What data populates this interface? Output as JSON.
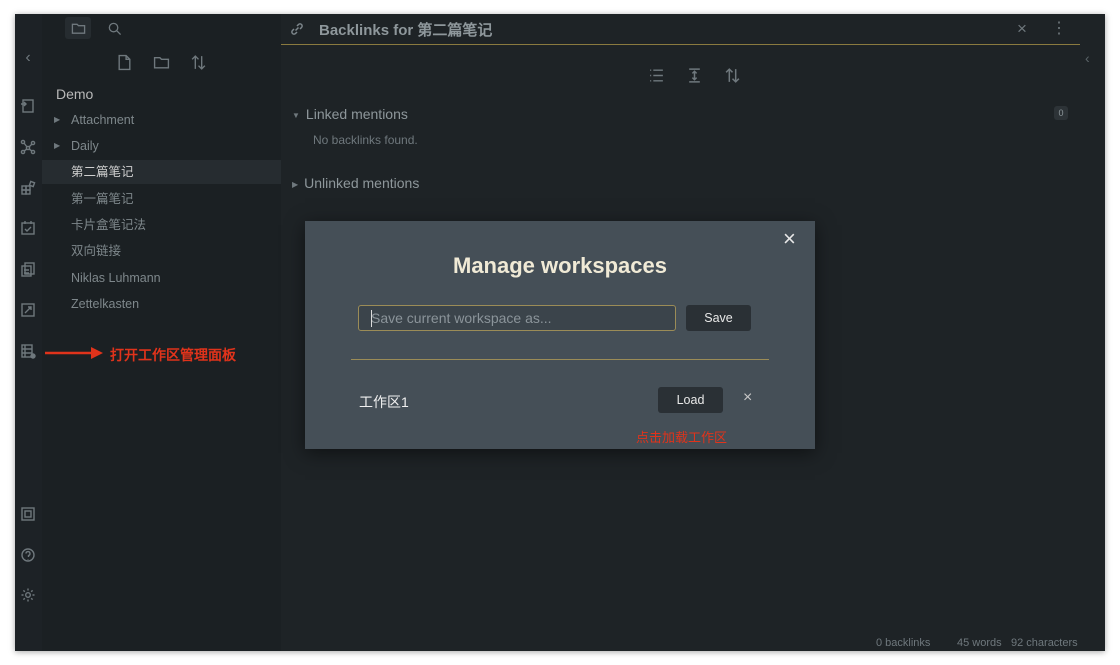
{
  "window": {
    "tab_title": "Backlinks for 第二篇笔记",
    "tab_close": "×",
    "tab_more": "⋮"
  },
  "ribbon": {
    "collapse": "‹",
    "icons": [
      "open-vault-icon",
      "graph-view-icon",
      "plugins-icon",
      "daily-note-icon",
      "templates-icon",
      "calendar-icon",
      "workspaces-icon",
      "vault-switch-icon",
      "help-icon",
      "settings-icon"
    ]
  },
  "sidebar": {
    "vault_name": "Demo",
    "items": [
      {
        "label": "Attachment",
        "folder": true
      },
      {
        "label": "Daily",
        "folder": true
      },
      {
        "label": "第二篇笔记",
        "folder": false,
        "active": true
      },
      {
        "label": "第一篇笔记",
        "folder": false
      },
      {
        "label": "卡片盒笔记法",
        "folder": false
      },
      {
        "label": "双向链接",
        "folder": false
      },
      {
        "label": "Niklas Luhmann",
        "folder": false
      },
      {
        "label": "Zettelkasten",
        "folder": false
      }
    ]
  },
  "backlinks": {
    "linked_label": "Linked mentions",
    "linked_count": "0",
    "no_backlinks": "No backlinks found.",
    "unlinked_label": "Unlinked mentions"
  },
  "status": {
    "backlinks": "0 backlinks",
    "words": "45 words",
    "characters": "92 characters"
  },
  "modal": {
    "title": "Manage workspaces",
    "close": "×",
    "input_placeholder": "Save current workspace as...",
    "input_value": "",
    "save_label": "Save",
    "workspaces": [
      {
        "name": "工作区1",
        "load_label": "Load",
        "remove": "×"
      }
    ]
  },
  "annotations": {
    "open_panel": "打开工作区管理面板",
    "click_load": "点击加载工作区"
  },
  "colors": {
    "accent": "#9b8c57",
    "annotation": "#e0331b",
    "modal_bg": "#454f57",
    "app_bg": "#1e2326"
  }
}
